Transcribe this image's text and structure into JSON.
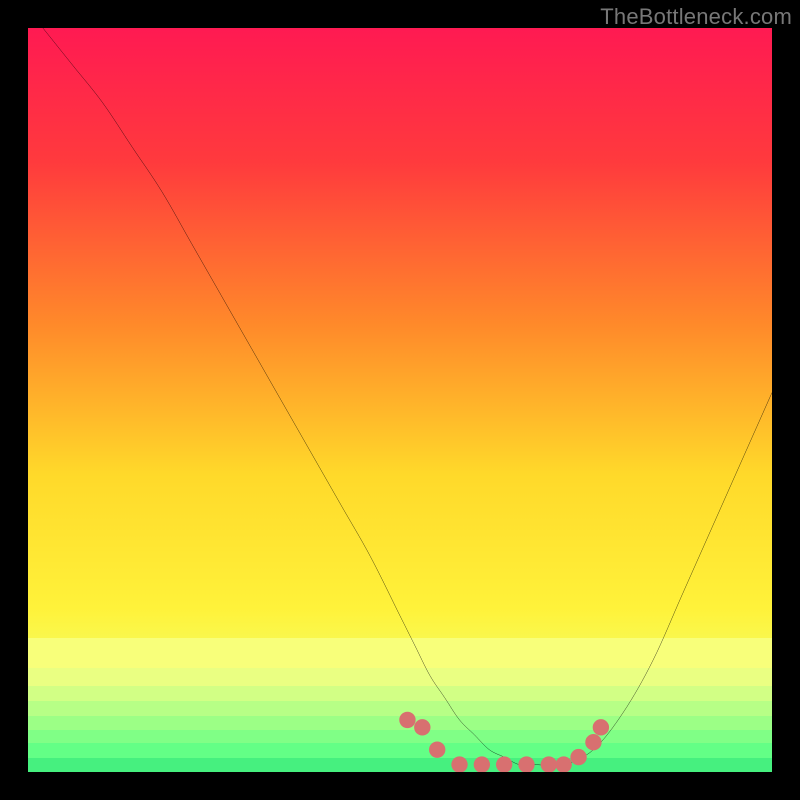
{
  "watermark": "TheBottleneck.com",
  "colors": {
    "black": "#000000",
    "curve": "#000000",
    "dots": "#cc6666",
    "dots_fill": "#d87070"
  },
  "chart_data": {
    "type": "line",
    "title": "",
    "xlabel": "",
    "ylabel": "",
    "xlim": [
      0,
      100
    ],
    "ylim": [
      0,
      100
    ],
    "grid": false,
    "legend": false,
    "series": [
      {
        "name": "bottleneck-curve",
        "x": [
          2,
          6,
          10,
          14,
          18,
          22,
          26,
          30,
          34,
          38,
          42,
          46,
          50,
          52,
          54,
          56,
          58,
          60,
          62,
          64,
          66,
          68,
          72,
          76,
          80,
          84,
          88,
          92,
          96,
          100
        ],
        "y": [
          100,
          95,
          90,
          84,
          78,
          71,
          64,
          57,
          50,
          43,
          36,
          29,
          21,
          17,
          13,
          10,
          7,
          5,
          3,
          2,
          1,
          1,
          1,
          3,
          8,
          15,
          24,
          33,
          42,
          51
        ]
      }
    ],
    "annotations": {
      "optimal_zone_dots": {
        "x": [
          51,
          53,
          55,
          58,
          61,
          64,
          67,
          70,
          72,
          74,
          76,
          77
        ],
        "y": [
          7,
          6,
          3,
          1,
          1,
          1,
          1,
          1,
          1,
          2,
          4,
          6
        ]
      }
    },
    "background_gradient_stops": [
      {
        "pct": 0,
        "color": "#ff1a52"
      },
      {
        "pct": 18,
        "color": "#ff3a3d"
      },
      {
        "pct": 40,
        "color": "#ff8a2a"
      },
      {
        "pct": 60,
        "color": "#ffd92a"
      },
      {
        "pct": 78,
        "color": "#fff23a"
      },
      {
        "pct": 88,
        "color": "#f2ff66"
      },
      {
        "pct": 100,
        "color": "#4dff88"
      }
    ],
    "bottom_bands": [
      {
        "top_pct": 82.0,
        "height_pct": 4.0,
        "color": "#f8ff7a"
      },
      {
        "top_pct": 86.0,
        "height_pct": 2.5,
        "color": "#eaff82"
      },
      {
        "top_pct": 88.5,
        "height_pct": 2.0,
        "color": "#d2ff85"
      },
      {
        "top_pct": 90.5,
        "height_pct": 2.0,
        "color": "#b7ff86"
      },
      {
        "top_pct": 92.5,
        "height_pct": 1.8,
        "color": "#9cff86"
      },
      {
        "top_pct": 94.3,
        "height_pct": 1.8,
        "color": "#80ff86"
      },
      {
        "top_pct": 96.1,
        "height_pct": 2.0,
        "color": "#63ff86"
      },
      {
        "top_pct": 98.1,
        "height_pct": 1.9,
        "color": "#46f07f"
      }
    ]
  }
}
